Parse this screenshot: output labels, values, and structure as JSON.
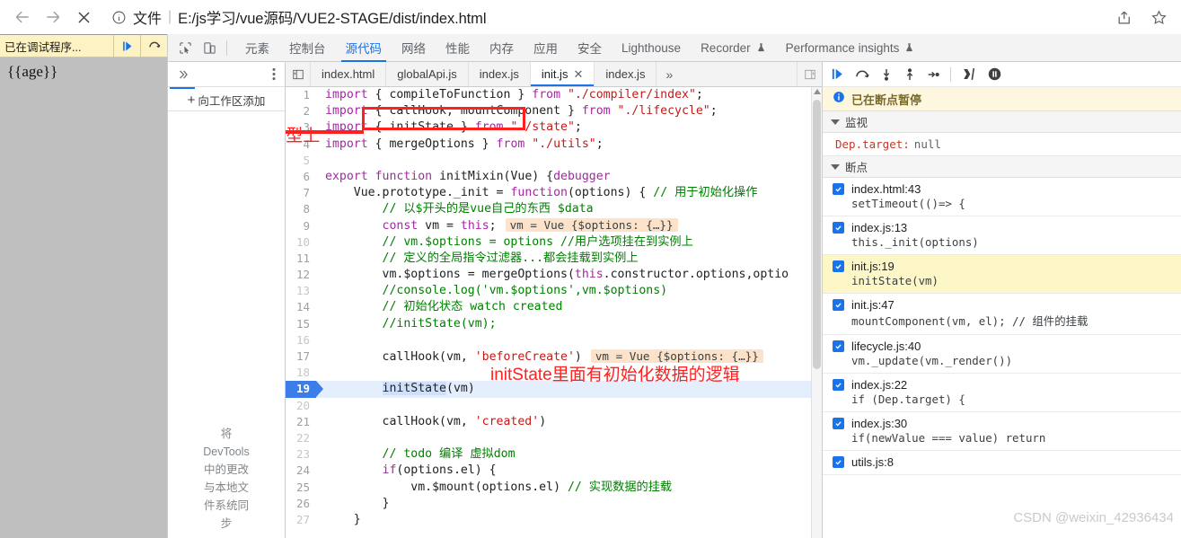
{
  "browser": {
    "back_icon": "back-arrow-icon",
    "forward_icon": "forward-arrow-icon",
    "stop_icon": "stop-x-icon",
    "info_icon": "page-info-icon",
    "scheme_label": "文件",
    "separator": "|",
    "url": "E:/js学习/vue源码/VUE2-STAGE/dist/index.html",
    "share_icon": "share-icon",
    "bookmark_icon": "star-icon"
  },
  "page_view": {
    "debug_banner_text": "已在调试程序...",
    "resume_icon": "resume-script-icon",
    "stepover_icon": "step-over-icon",
    "body_text": "{{age}}"
  },
  "devtools": {
    "inspect_icon": "inspect-element-icon",
    "device_icon": "device-toolbar-icon",
    "tabs": [
      {
        "label": "元素",
        "active": false
      },
      {
        "label": "控制台",
        "active": false
      },
      {
        "label": "源代码",
        "active": true
      },
      {
        "label": "网络",
        "active": false
      },
      {
        "label": "性能",
        "active": false
      },
      {
        "label": "内存",
        "active": false
      },
      {
        "label": "应用",
        "active": false
      },
      {
        "label": "安全",
        "active": false
      },
      {
        "label": "Lighthouse",
        "active": false
      },
      {
        "label": "Recorder",
        "active": false,
        "badge": "experiment-flask-icon"
      },
      {
        "label": "Performance insights",
        "active": false,
        "badge": "experiment-flask-icon"
      }
    ]
  },
  "navigator": {
    "more_chevron": "chevron-double-right-icon",
    "menu_dots": "more-options-icon",
    "add_folder_label": "向工作区添加",
    "plus_glyph": "+",
    "blurb": "将 DevTools 中的更改与本地文件系统同步"
  },
  "file_tabs": {
    "panel_toggle_icon": "show-navigator-icon",
    "more_glyph": "»",
    "right_panel_icon": "show-debugger-icon",
    "tabs": [
      {
        "label": "index.html",
        "active": false,
        "closable": false
      },
      {
        "label": "globalApi.js",
        "active": false,
        "closable": false
      },
      {
        "label": "index.js",
        "active": false,
        "closable": false
      },
      {
        "label": "init.js",
        "active": true,
        "closable": true,
        "close_glyph": "✕"
      },
      {
        "label": "index.js",
        "active": false,
        "closable": false
      }
    ]
  },
  "editor": {
    "execution_line": 19,
    "lines": [
      {
        "n": "1",
        "dim": false
      },
      {
        "n": "2",
        "dim": false
      },
      {
        "n": "3",
        "dim": false
      },
      {
        "n": "4",
        "dim": false
      },
      {
        "n": "5",
        "dim": true
      },
      {
        "n": "6",
        "dim": false
      },
      {
        "n": "7",
        "dim": false
      },
      {
        "n": "8",
        "dim": false
      },
      {
        "n": "9",
        "dim": false
      },
      {
        "n": "10",
        "dim": true
      },
      {
        "n": "11",
        "dim": false
      },
      {
        "n": "12",
        "dim": false
      },
      {
        "n": "13",
        "dim": true
      },
      {
        "n": "14",
        "dim": false
      },
      {
        "n": "15",
        "dim": false
      },
      {
        "n": "16",
        "dim": true
      },
      {
        "n": "17",
        "dim": false
      },
      {
        "n": "18",
        "dim": true
      },
      {
        "n": "19",
        "dim": false
      },
      {
        "n": "20",
        "dim": true
      },
      {
        "n": "21",
        "dim": false
      },
      {
        "n": "22",
        "dim": true
      },
      {
        "n": "23",
        "dim": false
      },
      {
        "n": "24",
        "dim": false
      },
      {
        "n": "25",
        "dim": false
      },
      {
        "n": "26",
        "dim": false
      },
      {
        "n": "27",
        "dim": true
      }
    ],
    "source_text": [
      "import { compileToFunction } from \"./compiler/index\";",
      "import { callHook, mountComponent } from \"./lifecycle\";",
      "import { initState } from \"./state\";",
      "import { mergeOptions } from \"./utils\";",
      "",
      "export function initMixin(Vue) {debugger",
      "    Vue.prototype._init = function(options) { // 用于初始化操作",
      "        // 以$开头的是vue自己的东西 $data",
      "        const vm = this;",
      "        // vm.$options = options //用户选项挂在到实例上",
      "        // 定义的全局指令过滤器...都会挂载到实例上",
      "        vm.$options = mergeOptions(this.constructor.options,optio",
      "        //console.log('vm.$options',vm.$options)",
      "        // 初始化状态 watch created",
      "        //initState(vm);",
      "",
      "        callHook(vm, 'beforeCreate')",
      "",
      "        initState(vm)",
      "",
      "        callHook(vm, 'created')",
      "",
      "        // todo 编译 虚拟dom",
      "        if(options.el) {",
      "            vm.$mount(options.el) // 实现数据的挂载",
      "        }",
      "    }"
    ],
    "inline_values": [
      {
        "line": 9,
        "text": "vm = Vue {$options: {…}}"
      },
      {
        "line": 17,
        "text": "vm = Vue {$options: {…}}"
      }
    ],
    "annotations": [
      {
        "text": "init方法在原型上",
        "name": "annotation-init-prototype"
      },
      {
        "text": "initState里面有初始化数据的逻辑",
        "name": "annotation-initstate-logic"
      }
    ]
  },
  "debugger": {
    "toolbar": [
      {
        "icon": "resume-script-icon"
      },
      {
        "icon": "step-over-icon"
      },
      {
        "icon": "step-into-icon"
      },
      {
        "icon": "step-out-icon"
      },
      {
        "icon": "step-icon"
      },
      {
        "icon": "deactivate-breakpoints-icon"
      },
      {
        "icon": "pause-on-exceptions-icon"
      }
    ],
    "paused_banner": {
      "icon": "info-circle-icon",
      "text": "已在断点暂停"
    },
    "watch_section": {
      "title": "监视",
      "expression": "Dep.target:",
      "value": "null"
    },
    "breakpoints_section": {
      "title": "断点"
    },
    "breakpoints": [
      {
        "file": "index.html:43",
        "code": "setTimeout(()=> {",
        "checked": true,
        "highlighted": false
      },
      {
        "file": "index.js:13",
        "code": "this._init(options)",
        "checked": true,
        "highlighted": false
      },
      {
        "file": "init.js:19",
        "code": "initState(vm)",
        "checked": true,
        "highlighted": true
      },
      {
        "file": "init.js:47",
        "code": "mountComponent(vm, el); // 组件的挂载",
        "checked": true,
        "highlighted": false,
        "comment_from": 27
      },
      {
        "file": "lifecycle.js:40",
        "code": "vm._update(vm._render())",
        "checked": true,
        "highlighted": false
      },
      {
        "file": "index.js:22",
        "code": "if (Dep.target) {",
        "checked": true,
        "highlighted": false
      },
      {
        "file": "index.js:30",
        "code": "if(newValue === value) return",
        "checked": true,
        "highlighted": false
      },
      {
        "file": "utils.js:8",
        "code": "",
        "checked": true,
        "highlighted": false
      }
    ]
  },
  "watermark": "CSDN @weixin_42936434",
  "colors": {
    "accent": "#1a73e8",
    "annotation_red": "#ff2020",
    "paused_yellow": "#fdf7e0",
    "breakpoint_highlight": "#fdf7c8",
    "exec_line": "#e4eefd"
  }
}
